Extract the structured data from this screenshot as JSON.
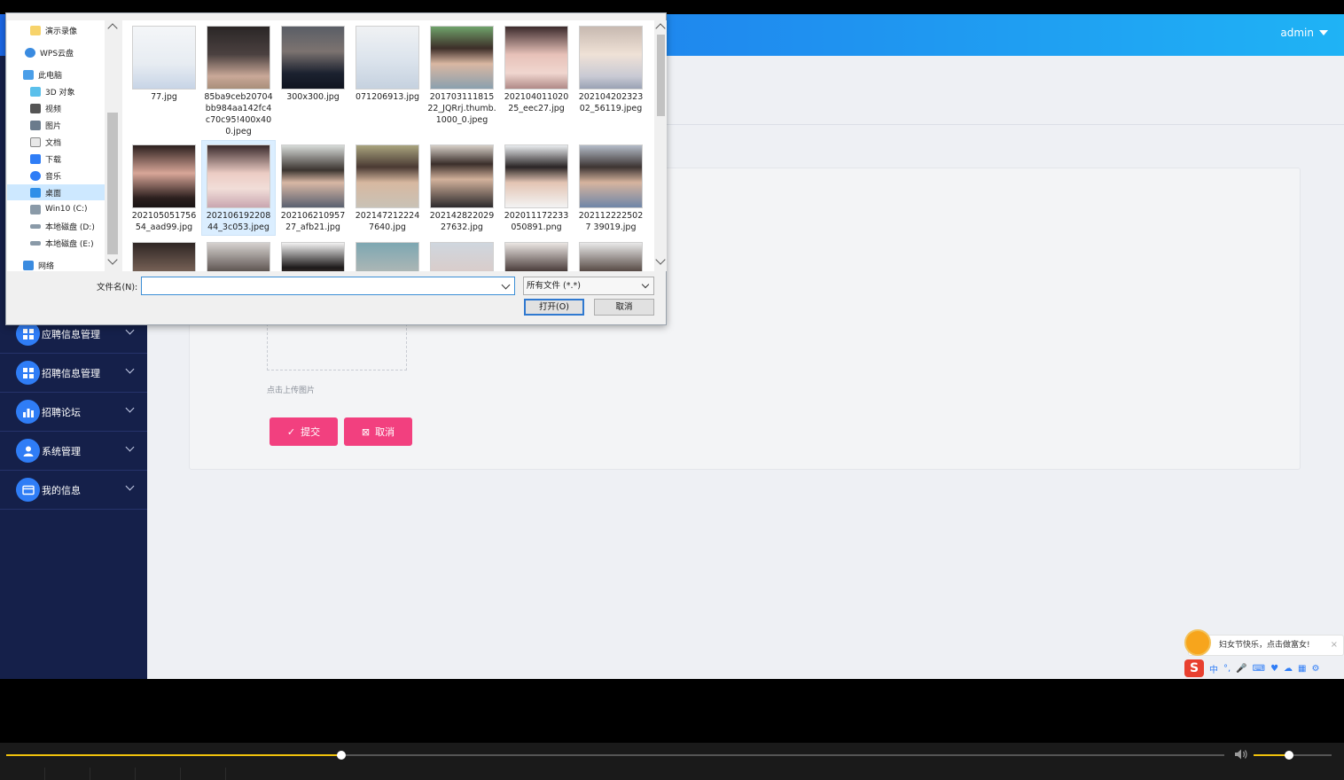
{
  "header": {
    "user": "admin"
  },
  "sidebar": {
    "items": [
      {
        "label": "应聘信息管理",
        "icon": "grid-icon"
      },
      {
        "label": "招聘信息管理",
        "icon": "grid-icon"
      },
      {
        "label": "招聘论坛",
        "icon": "bar-chart-icon"
      },
      {
        "label": "系统管理",
        "icon": "user-icon"
      },
      {
        "label": "我的信息",
        "icon": "card-icon"
      }
    ]
  },
  "form": {
    "upload_hint": "点击上传图片",
    "submit_label": "提交",
    "cancel_label": "取消",
    "accent_color": "#f2407f"
  },
  "dialog": {
    "nav": [
      {
        "label": "演示录像",
        "icon": "folder-icon"
      },
      {
        "label": "WPS云盘",
        "icon": "cloud-icon"
      },
      {
        "label": "此电脑",
        "icon": "computer-icon"
      },
      {
        "label": "3D 对象",
        "icon": "cube-icon"
      },
      {
        "label": "视频",
        "icon": "video-icon"
      },
      {
        "label": "图片",
        "icon": "picture-icon"
      },
      {
        "label": "文档",
        "icon": "document-icon"
      },
      {
        "label": "下载",
        "icon": "download-icon"
      },
      {
        "label": "音乐",
        "icon": "music-icon"
      },
      {
        "label": "桌面",
        "icon": "desktop-icon",
        "selected": true
      },
      {
        "label": "Win10 (C:)",
        "icon": "drive-icon"
      },
      {
        "label": "本地磁盘 (D:)",
        "icon": "drive-icon"
      },
      {
        "label": "本地磁盘 (E:)",
        "icon": "drive-icon"
      },
      {
        "label": "网络",
        "icon": "network-icon"
      }
    ],
    "files_row1": [
      {
        "name": "77.jpg"
      },
      {
        "name": "85ba9ceb20704bb984aa142fc4c70c95!400x400.jpeg"
      },
      {
        "name": "300x300.jpg"
      },
      {
        "name": "071206913.jpg"
      },
      {
        "name": "20170311181522_JQRrj.thumb.1000_0.jpeg"
      },
      {
        "name": "20210401102025_eec27.jpg"
      },
      {
        "name": "20210420232302_56119.jpeg"
      }
    ],
    "files_row2": [
      {
        "name": "20210505175654_aad99.jpg"
      },
      {
        "name": "20210619220844_3c053.jpeg",
        "selected": true
      },
      {
        "name": "20210621095727_afb21.jpg"
      },
      {
        "name": "2021472122247640.jpg"
      },
      {
        "name": "20214282202927632.jpg"
      },
      {
        "name": "202011172233050891.png"
      },
      {
        "name": "2021122225027 39019.jpg"
      }
    ],
    "filename_label": "文件名(N):",
    "filename_value": "",
    "filetype": "所有文件 (*.*)",
    "open_label": "打开(O)",
    "cancel_label": "取消"
  },
  "ime": {
    "tip": "妇女节快乐，点击做富女!",
    "logo": "S",
    "mode": "中"
  },
  "player": {
    "progress": 0.275,
    "volume": 0.45,
    "accent_color": "#f0c20c"
  }
}
